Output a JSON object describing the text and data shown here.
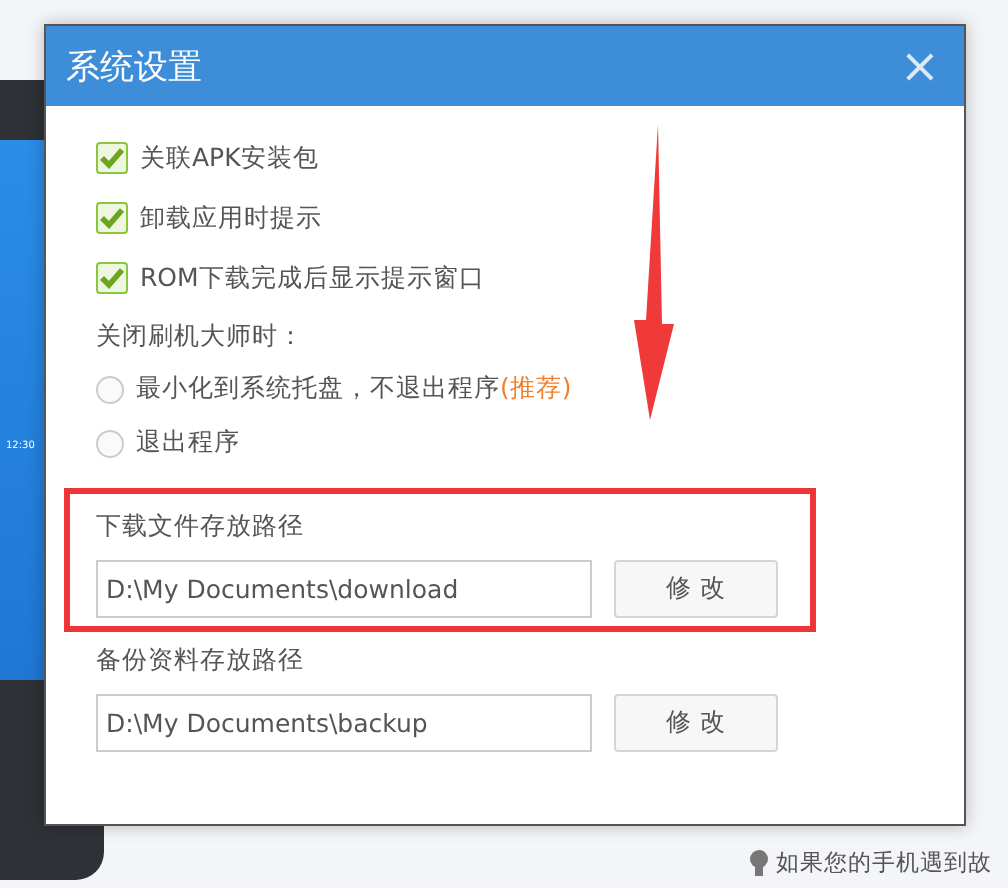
{
  "background": {
    "phone_clock": "12:30",
    "hint": "如果您的手机遇到故"
  },
  "dialog": {
    "title": "系统设置",
    "close": "×"
  },
  "options": [
    {
      "label": "关联APK安装包",
      "checked": true
    },
    {
      "label": "卸载应用时提示",
      "checked": true
    },
    {
      "label": "ROM下载完成后显示提示窗口",
      "checked": true
    }
  ],
  "exit_label": "关闭刷机大师时：",
  "exit_choices": [
    {
      "label": "最小化到系统托盘，不退出程序",
      "note": "(推荐)",
      "selected": false
    },
    {
      "label": "退出程序",
      "selected": false
    }
  ],
  "paths": [
    {
      "label": "下载文件存放路径",
      "value": "D:\\My Documents\\download",
      "button": "修 改",
      "highlighted": true
    },
    {
      "label": "备份资料存放路径",
      "value": "D:\\My Documents\\backup",
      "button": "修 改",
      "highlighted": false
    }
  ]
}
